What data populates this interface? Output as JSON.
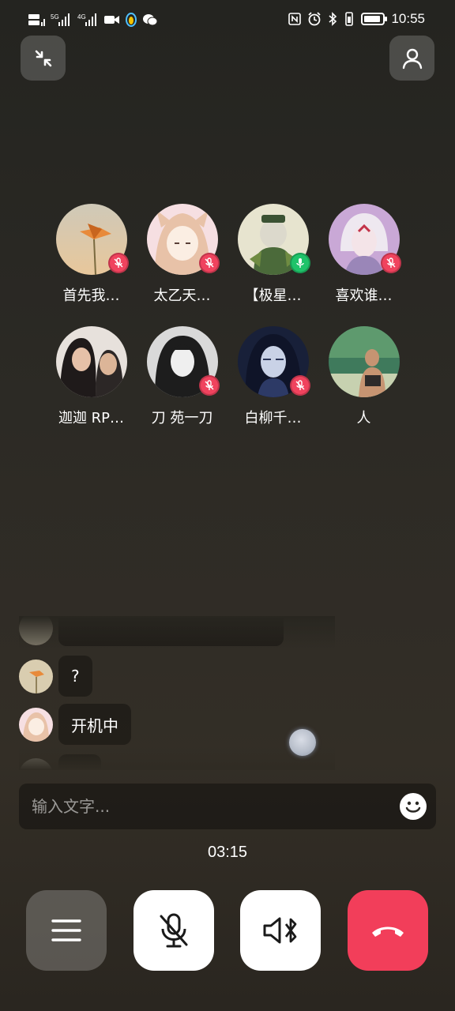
{
  "status_bar": {
    "time": "10:55",
    "network_left": "HD 5G 4G",
    "battery_level": 0.9
  },
  "members": [
    {
      "name": "首先我…",
      "mic": "muted"
    },
    {
      "name": "太乙天…",
      "mic": "muted"
    },
    {
      "name": "【极星…",
      "mic": "on"
    },
    {
      "name": "喜欢谁…",
      "mic": "muted"
    },
    {
      "name": "迦迦 RP…",
      "mic": "none"
    },
    {
      "name": "刀 苑一刀",
      "mic": "muted"
    },
    {
      "name": "白柳千…",
      "mic": "muted"
    },
    {
      "name": "人",
      "mic": "none"
    }
  ],
  "chat": {
    "messages": [
      {
        "text": "?"
      },
      {
        "text": "开机中"
      }
    ]
  },
  "input": {
    "placeholder": "输入文字..."
  },
  "call": {
    "timer": "03:15"
  },
  "colors": {
    "hangup": "#f23e5a",
    "muted_badge": "#f0435e",
    "mic_on_badge": "#1fc36a"
  },
  "icons": {
    "minimize": "minimize-arrows-icon",
    "profile": "person-icon",
    "emoji": "smiley-icon",
    "menu": "menu-icon",
    "mic": "mic-off-icon",
    "speaker": "speaker-bluetooth-icon",
    "hangup": "hangup-icon"
  }
}
